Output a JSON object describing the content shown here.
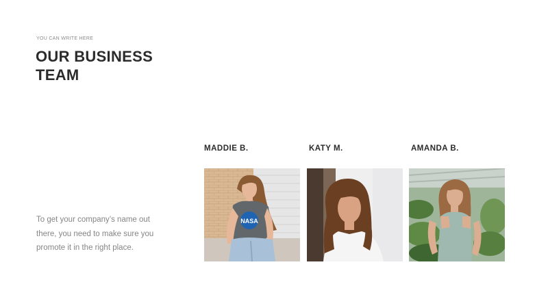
{
  "header": {
    "eyebrow": "YOU CAN WRITE HERE",
    "title_line1": "OUR BUSINESS",
    "title_line2": "TEAM"
  },
  "description": {
    "line1": "To get your company’s name out",
    "line2": "there, you need to make sure you",
    "line3": "promote it in the right place."
  },
  "team": [
    {
      "name": "MADDIE B.",
      "photo_icon": "person-photo",
      "shirt_print": "NASA"
    },
    {
      "name": "KATY M.",
      "photo_icon": "person-photo"
    },
    {
      "name": "AMANDA B.",
      "photo_icon": "person-photo"
    }
  ],
  "colors": {
    "heading": "#2b2b2b",
    "muted": "#858585",
    "eyebrow": "#8a8a8a",
    "background": "#ffffff"
  }
}
